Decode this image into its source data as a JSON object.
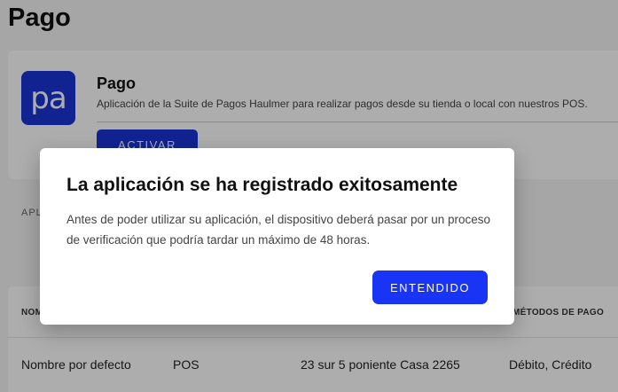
{
  "page": {
    "title": "Pago"
  },
  "app_card": {
    "logo_text": "pa",
    "name": "Pago",
    "description": "Aplicación de la Suite de Pagos Haulmer para realizar pagos desde su tienda o local con nuestros POS.",
    "activate_label": "ACTIVAR"
  },
  "section": {
    "label": "APL"
  },
  "table": {
    "headers": [
      "NOM",
      "MÉTODOS DE PAGO"
    ],
    "rows": [
      [
        "Nombre por defecto",
        "POS",
        "23 sur 5 poniente Casa 2265",
        "Débito, Crédito"
      ]
    ]
  },
  "dialog": {
    "title": "La aplicación se ha registrado exitosamente",
    "body": "Antes de poder utilizar su aplicación, el dispositivo deberá pasar por un proceso de verificación que podría tardar un máximo de 48 horas.",
    "confirm_label": "ENTENDIDO"
  },
  "colors": {
    "primary": "#1a34d6",
    "dialog_button": "#1a34f5",
    "overlay": "rgba(0,0,0,0.32)"
  }
}
